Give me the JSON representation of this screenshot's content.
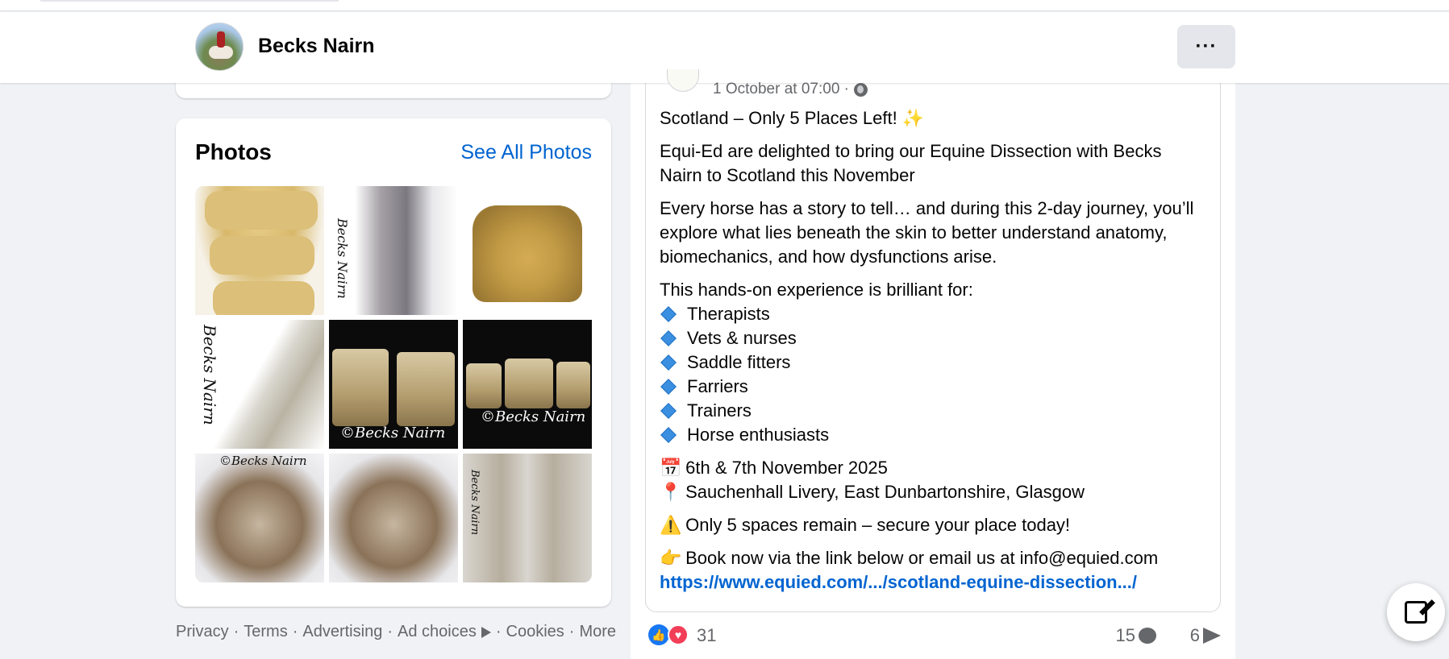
{
  "profile": {
    "name": "Becks Nairn",
    "more_label": "···"
  },
  "photos": {
    "title": "Photos",
    "see_all": "See All Photos",
    "items": [
      {
        "signature": ""
      },
      {
        "signature": "Becks Nairn"
      },
      {
        "signature": ""
      },
      {
        "signature": "Becks Nairn"
      },
      {
        "signature": "©Becks Nairn"
      },
      {
        "signature": "©Becks Nairn"
      },
      {
        "signature": "©Becks Nairn"
      },
      {
        "signature": ""
      },
      {
        "signature": "Becks Nairn"
      }
    ]
  },
  "footer": {
    "links": [
      "Privacy",
      "Terms",
      "Advertising",
      "Ad choices",
      "Cookies",
      "More"
    ],
    "separator": "·"
  },
  "post": {
    "timestamp": "1 October at 07:00 ·",
    "headline": "Scotland – Only 5 Places Left! ✨",
    "intro": "Equi-Ed are delighted to bring our Equine Dissection with Becks Nairn to Scotland this November",
    "story": "Every horse has a story to tell… and during this 2-day journey, you’ll explore what lies beneath the skin to better understand anatomy, biomechanics, and how dysfunctions arise.",
    "list_intro": "This hands-on experience is brilliant for:",
    "audience": [
      "Therapists",
      "Vets & nurses",
      "Saddle fitters",
      "Farriers",
      "Trainers",
      "Horse enthusiasts"
    ],
    "date_emoji": "📅",
    "date": "6th & 7th November 2025",
    "location_emoji": "📍",
    "location": "Sauchenhall Livery, East Dunbartonshire, Glasgow",
    "warning_emoji": "⚠️",
    "warning": "Only 5 spaces remain – secure your place today!",
    "book_emoji": "👉",
    "book": "Book now via the link below or email us at info@equied.com",
    "link": "https://www.equied.com/.../scotland-equine-dissection.../"
  },
  "reactions": {
    "count": "31",
    "comments": "15",
    "shares": "6"
  },
  "colors": {
    "accent": "#0064d1",
    "like": "#1877f2",
    "love": "#f33e58",
    "background": "#f0f2f5"
  }
}
